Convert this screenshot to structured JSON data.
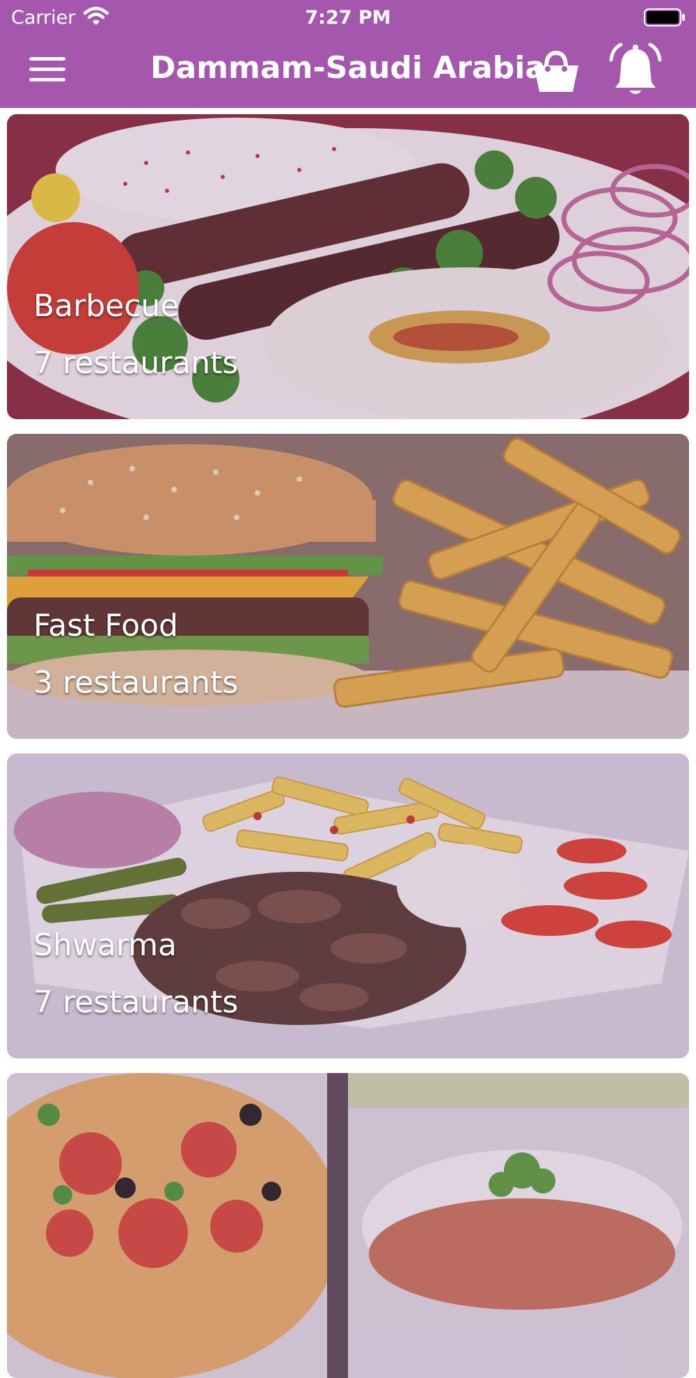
{
  "status_bar": {
    "carrier": "Carrier",
    "time": "7:27 PM"
  },
  "header": {
    "title": "Dammam-Saudi Arabia",
    "menu_icon": "hamburger-menu-icon",
    "basket_icon": "shopping-basket-icon",
    "bell_icon": "notification-bell-icon"
  },
  "colors": {
    "header_bg": "#a557ad",
    "text": "#ffffff"
  },
  "categories": [
    {
      "name": "Barbecue",
      "count": "7 restaurants"
    },
    {
      "name": "Fast Food",
      "count": "3 restaurants"
    },
    {
      "name": "Shwarma",
      "count": "7 restaurants"
    },
    {
      "name": "",
      "count": ""
    }
  ]
}
